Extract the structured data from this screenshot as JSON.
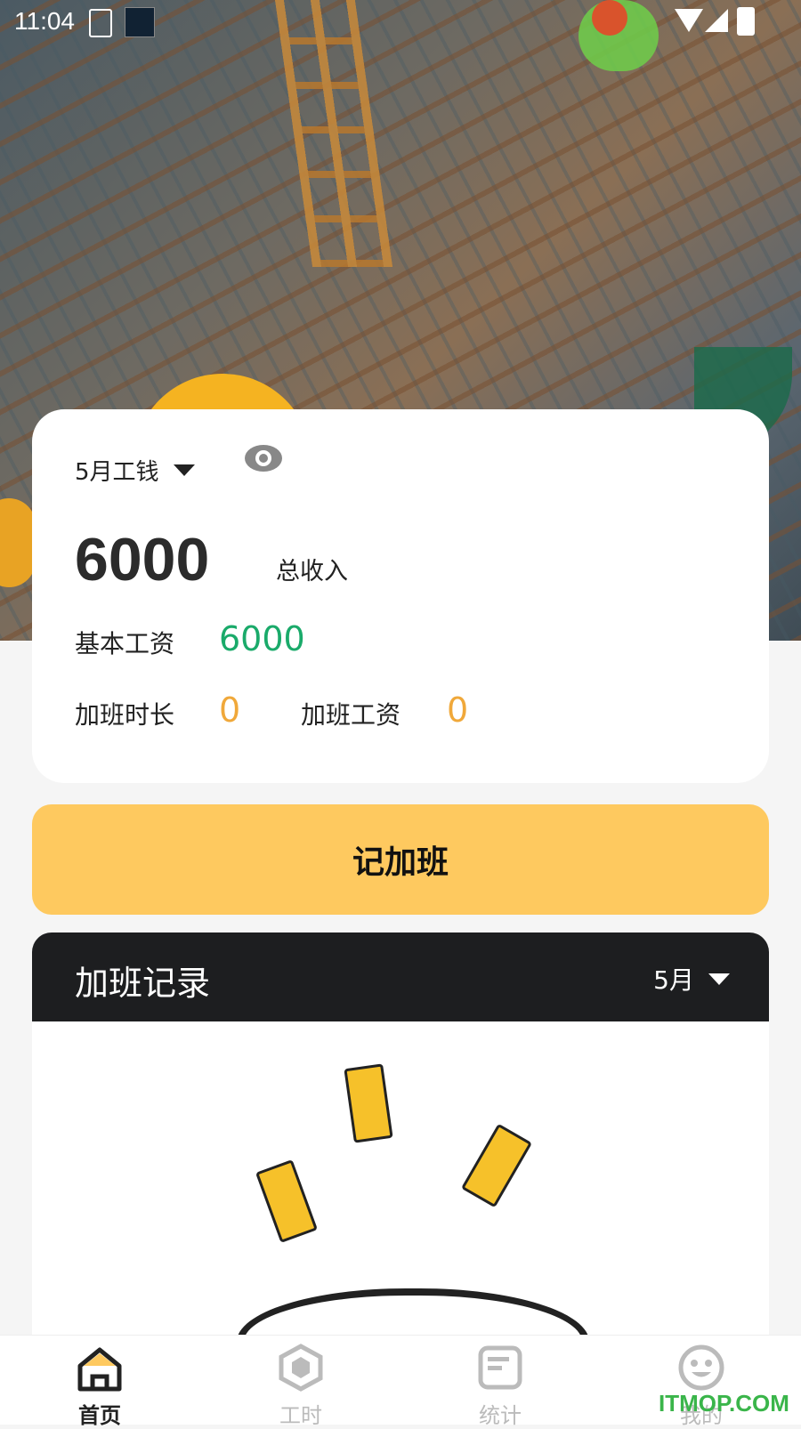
{
  "status_bar": {
    "time": "11:04"
  },
  "summary": {
    "month_selector": "5月工钱",
    "total_amount": "6000",
    "total_label": "总收入",
    "base_salary_label": "基本工资",
    "base_salary_value": "6000",
    "overtime_hours_label": "加班时长",
    "overtime_hours_value": "0",
    "overtime_pay_label": "加班工资",
    "overtime_pay_value": "0"
  },
  "action": {
    "record_overtime_label": "记加班"
  },
  "records": {
    "title": "加班记录",
    "month": "5月"
  },
  "tabs": [
    {
      "label": "首页",
      "icon": "home-icon",
      "active": true
    },
    {
      "label": "工时",
      "icon": "hexagon-icon",
      "active": false
    },
    {
      "label": "统计",
      "icon": "stats-doc-icon",
      "active": false
    },
    {
      "label": "我的",
      "icon": "smiley-icon",
      "active": false
    }
  ],
  "watermark": "ITMOP.COM",
  "colors": {
    "accent": "#fec95f",
    "green": "#1aaa6a",
    "orange": "#f0a83a",
    "dark": "#1d1e20"
  }
}
